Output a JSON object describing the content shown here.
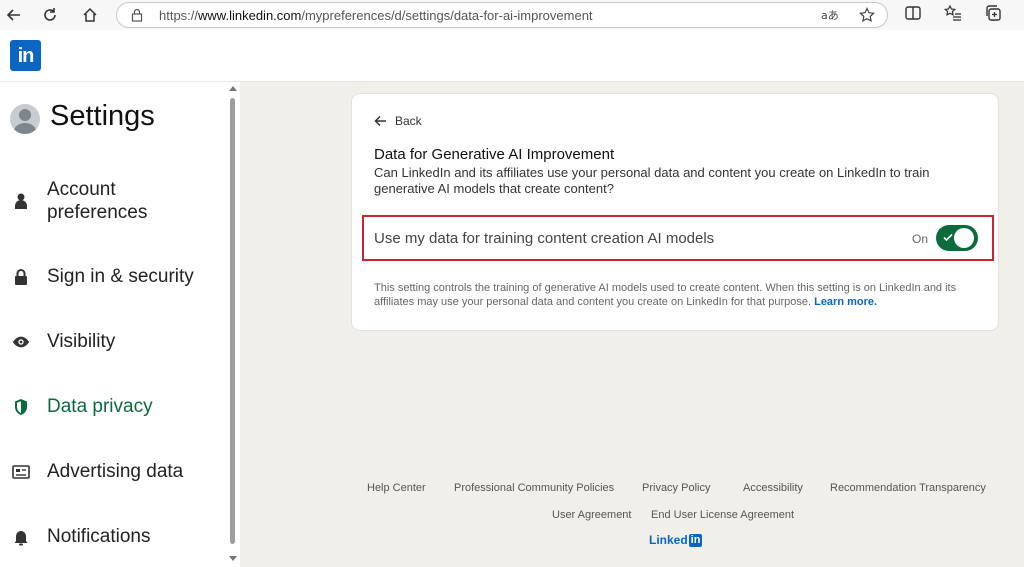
{
  "browser": {
    "url_prefix": "https://",
    "url_domain": "www.linkedin.com",
    "url_path": "/mypreferences/d/settings/data-for-ai-improvement"
  },
  "brand": {
    "logo_text": "in",
    "color": "#0a66c2"
  },
  "sidebar": {
    "title": "Settings",
    "items": [
      {
        "label": "Account preferences",
        "icon": "person-icon"
      },
      {
        "label": "Sign in & security",
        "icon": "lock-icon"
      },
      {
        "label": "Visibility",
        "icon": "eye-icon"
      },
      {
        "label": "Data privacy",
        "icon": "shield-icon",
        "active": true
      },
      {
        "label": "Advertising data",
        "icon": "ad-card-icon"
      },
      {
        "label": "Notifications",
        "icon": "bell-icon"
      }
    ]
  },
  "card": {
    "back_label": "Back",
    "title": "Data for Generative AI Improvement",
    "description": "Can LinkedIn and its affiliates use your personal data and content you create on LinkedIn to train generative AI models that create content?",
    "toggle_label": "Use my data for training content creation AI models",
    "toggle_state": "On",
    "toggle_on": true,
    "footnote": "This setting controls the training of generative AI models used to create content. When this setting is on LinkedIn and its affiliates may use your personal data and content you create on LinkedIn for that purpose.",
    "learn_more": "Learn more."
  },
  "footer": {
    "links": [
      "Help Center",
      "Professional Community Policies",
      "Privacy Policy",
      "Accessibility",
      "Recommendation Transparency",
      "User Agreement",
      "End User License Agreement"
    ],
    "logo_word": "Linked",
    "logo_box": "in"
  },
  "colors": {
    "accent_green": "#0b6b3a",
    "highlight_red": "#c8262f",
    "link_blue": "#0a66c2"
  }
}
